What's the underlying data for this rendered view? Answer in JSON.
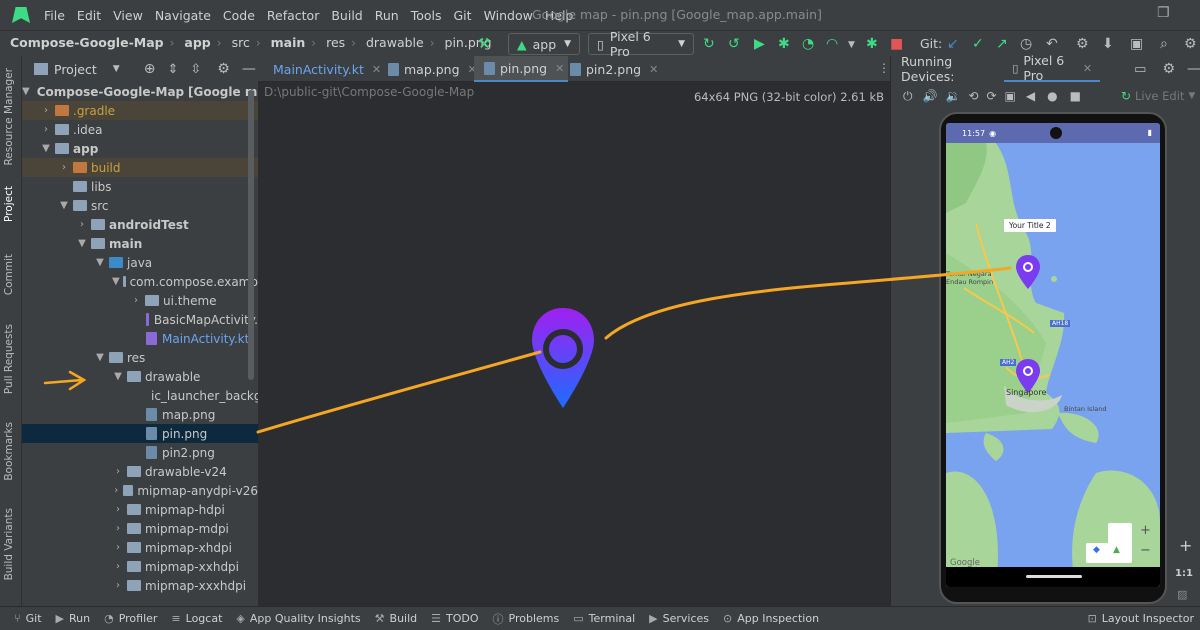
{
  "menu": [
    "File",
    "Edit",
    "View",
    "Navigate",
    "Code",
    "Refactor",
    "Build",
    "Run",
    "Tools",
    "Git",
    "Window",
    "Help"
  ],
  "window_title": "Google map - pin.png [Google_map.app.main]",
  "breadcrumbs": [
    "Compose-Google-Map",
    "app",
    "src",
    "main",
    "res",
    "drawable",
    "pin.png"
  ],
  "run_config": "app",
  "device": "Pixel 6 Pro",
  "git_label": "Git:",
  "project_header": "Project",
  "tree": [
    {
      "label": "Compose-Google-Map",
      "extra": "[Google map]"
    },
    {
      "label": ".gradle"
    },
    {
      "label": ".idea"
    },
    {
      "label": "app"
    },
    {
      "label": "build"
    },
    {
      "label": "libs"
    },
    {
      "label": "src"
    },
    {
      "label": "androidTest"
    },
    {
      "label": "main"
    },
    {
      "label": "java"
    },
    {
      "label": "com.compose.examp"
    },
    {
      "label": "ui.theme"
    },
    {
      "label": "BasicMapActivity."
    },
    {
      "label": "MainActivity.kt"
    },
    {
      "label": "res"
    },
    {
      "label": "drawable"
    },
    {
      "label": "ic_launcher_backg"
    },
    {
      "label": "map.png"
    },
    {
      "label": "pin.png"
    },
    {
      "label": "pin2.png"
    },
    {
      "label": "drawable-v24"
    },
    {
      "label": "mipmap-anydpi-v26"
    },
    {
      "label": "mipmap-hdpi"
    },
    {
      "label": "mipmap-mdpi"
    },
    {
      "label": "mipmap-xhdpi"
    },
    {
      "label": "mipmap-xxhdpi"
    },
    {
      "label": "mipmap-xxxhdpi"
    }
  ],
  "editor_tabs": [
    "MainActivity.kt",
    "map.png",
    "pin.png",
    "pin2.png"
  ],
  "editor_path": "D:\\public-git\\Compose-Google-Map",
  "image_info": "64x64 PNG (32-bit color) 2.61 kB",
  "side_tabs": [
    "Resource Manager",
    "Project",
    "Commit",
    "Pull Requests",
    "Bookmarks",
    "Build Variants"
  ],
  "running_devices": {
    "label": "Running Devices:",
    "device_tab": "Pixel 6 Pro",
    "live_edit": "Live Edit"
  },
  "phone": {
    "time": "11:57",
    "marker_title": "Your Title 2",
    "place_singapore": "Singapore",
    "place_tamannegara": "Tamar Negara Endau Rompin",
    "place_bintan": "Bintan Island",
    "road_ah18": "AH18",
    "road_ah2": "AH2",
    "google": "Google",
    "zoom_in": "+",
    "zoom_out": "−"
  },
  "side_controls": {
    "plus": "+",
    "ratio": "1:1"
  },
  "bottom_bar": [
    "Git",
    "Run",
    "Profiler",
    "Logcat",
    "App Quality Insights",
    "Build",
    "TODO",
    "Problems",
    "Terminal",
    "Services",
    "App Inspection",
    "Layout Inspector"
  ],
  "colors": {
    "accent": "#4a88c7",
    "arrow": "#f5a623",
    "pin_top": "#a020f0",
    "pin_bottom": "#1e6cff"
  }
}
